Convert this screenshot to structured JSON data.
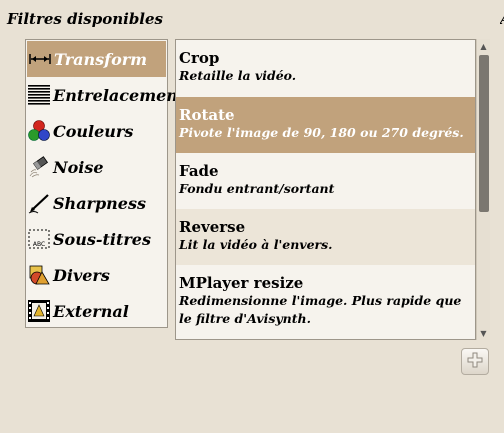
{
  "header": {
    "title": "Filtres disponibles",
    "edge_glyph": "A"
  },
  "categories": [
    {
      "label": "Transform",
      "icon": "transform-arrow-icon",
      "selected": true
    },
    {
      "label": "Entrelacement",
      "icon": "interlace-lines-icon",
      "selected": false
    },
    {
      "label": "Couleurs",
      "icon": "color-balls-icon",
      "selected": false
    },
    {
      "label": "Noise",
      "icon": "noise-eraser-icon",
      "selected": false
    },
    {
      "label": "Sharpness",
      "icon": "sharpness-pen-icon",
      "selected": false
    },
    {
      "label": "Sous-titres",
      "icon": "subtitles-icon",
      "selected": false
    },
    {
      "label": "Divers",
      "icon": "misc-shapes-icon",
      "selected": false
    },
    {
      "label": "External",
      "icon": "external-film-icon",
      "selected": false
    }
  ],
  "filters": [
    {
      "name": "Crop",
      "description": "Retaille la vidéo."
    },
    {
      "name": "Rotate",
      "description": "Pivote l'image de 90, 180 ou 270 degrés."
    },
    {
      "name": "Fade",
      "description": "Fondu entrant/sortant"
    },
    {
      "name": "Reverse",
      "description": "Lit la vidéo à l'envers."
    },
    {
      "name": "MPlayer resize",
      "description": "Redimensionne l'image. Plus rapide que le filtre d'Avisynth."
    }
  ],
  "scrollbar": {
    "up_glyph": "▲",
    "down_glyph": "▼"
  },
  "colors": {
    "selection": "#c1a27c",
    "background": "#e8e1d4",
    "list_bg": "#f6f3ed"
  }
}
